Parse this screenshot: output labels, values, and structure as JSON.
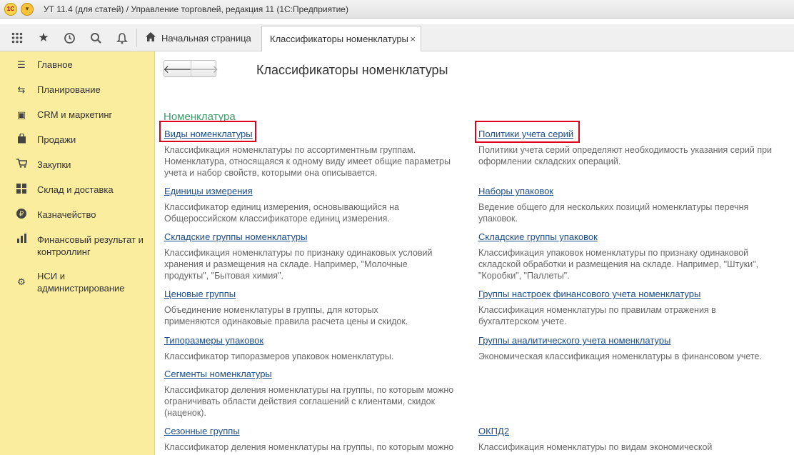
{
  "window": {
    "logo": "1С",
    "title": "УТ 11.4 (для статей) / Управление торговлей, редакция 11  (1С:Предприятие)"
  },
  "toolbar": {
    "icons": [
      "apps-grid-icon",
      "star-icon",
      "history-icon",
      "search-icon",
      "bell-icon"
    ],
    "home_tab": "Начальная страница",
    "active_tab": "Классификаторы номенклатуры",
    "close_glyph": "×"
  },
  "sidebar": {
    "items": [
      {
        "label": "Главное",
        "icon": "menu-lines-icon"
      },
      {
        "label": "Планирование",
        "icon": "planning-icon"
      },
      {
        "label": "CRM и маркетинг",
        "icon": "crm-icon"
      },
      {
        "label": "Продажи",
        "icon": "shopping-bag-icon"
      },
      {
        "label": "Закупки",
        "icon": "cart-icon"
      },
      {
        "label": "Склад и доставка",
        "icon": "warehouse-icon"
      },
      {
        "label": "Казначейство",
        "icon": "ruble-icon"
      },
      {
        "label": "Финансовый результат и контроллинг",
        "icon": "bar-chart-icon"
      },
      {
        "label": "НСИ и администрирование",
        "icon": "gear-icon"
      }
    ]
  },
  "main": {
    "title": "Классификаторы номенклатуры",
    "section": "Номенклатура",
    "left": [
      {
        "link": "Виды номенклатуры",
        "desc": "Классификация номенклатуры по ассортиментным группам. Номенклатура, относящаяся к одному виду имеет общие параметры учета и набор свойств, которыми она описывается."
      },
      {
        "link": "Единицы измерения",
        "desc": "Классификатор единиц измерения, основывающийся на Общероссийском классификаторе единиц измерения."
      },
      {
        "link": "Складские группы номенклатуры",
        "desc": "Классификация номенклатуры по признаку одинаковых условий хранения и размещения на складе. Например, \"Молочные продукты\", \"Бытовая химия\"."
      },
      {
        "link": "Ценовые группы",
        "desc": "Объединение номенклатуры в группы, для которых применяются одинаковые правила расчета цены и скидок."
      },
      {
        "link": "Типоразмеры упаковок",
        "desc": "Классификатор типоразмеров упаковок номенклатуры."
      },
      {
        "link": "Сегменты номенклатуры",
        "desc": "Классификатор деления номенклатуры на группы, по которым можно ограничивать области действия соглашений с клиентами, скидок (наценок)."
      },
      {
        "link": "Сезонные группы",
        "desc": "Классификатор деления номенклатуры на группы, по которым можно"
      }
    ],
    "right": [
      {
        "link": "Политики учета серий",
        "desc": "Политики учета серий определяют необходимость указания серий при оформлении складских операций."
      },
      {
        "link": "Наборы упаковок",
        "desc": "Ведение общего для нескольких позиций номенклатуры перечня упаковок."
      },
      {
        "link": "Складские группы упаковок",
        "desc": "Классификация упаковок номенклатуры по признаку одинаковой складской обработки и размещения на складе. Например, \"Штуки\", \"Коробки\", \"Паллеты\"."
      },
      {
        "link": "Группы настроек финансового учета номенклатуры",
        "desc": "Классификация номенклатуры по правилам отражения в бухгалтерском учете."
      },
      {
        "link": "Группы аналитического учета номенклатуры",
        "desc": "Экономическая классификация номенклатуры в финансовом учете."
      },
      {
        "link": "ОКПД2",
        "desc": "Классификация номенклатуры по  видам экономической"
      }
    ]
  },
  "colors": {
    "sidebar_bg": "#fbed9e",
    "link": "#1c4d8c",
    "section_title": "#3f9b6a",
    "highlight": "#e0001b"
  }
}
